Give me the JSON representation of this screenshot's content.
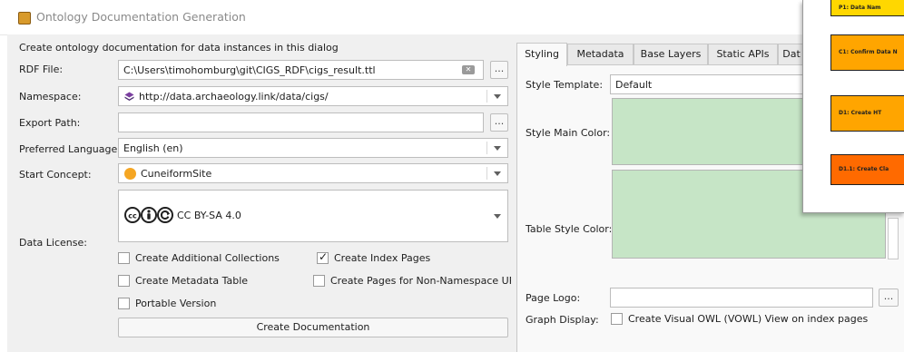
{
  "window": {
    "title": "Ontology Documentation Generation"
  },
  "left": {
    "intro": "Create ontology documentation for data instances in this dialog",
    "rdf_file": {
      "label": "RDF File:",
      "value": "C:\\Users\\timohomburg\\git\\CIGS_RDF\\cigs_result.ttl",
      "browse": "..."
    },
    "namespace": {
      "label": "Namespace:",
      "value": "http://data.archaeology.link/data/cigs/"
    },
    "export_path": {
      "label": "Export Path:",
      "value": "",
      "browse": "..."
    },
    "preferred_language": {
      "label": "Preferred Language:",
      "value": "English (en)"
    },
    "start_concept": {
      "label": "Start Concept:",
      "value": "CuneiformSite"
    },
    "data_license": {
      "label": "Data License:",
      "value": "CC BY-SA 4.0"
    },
    "checkboxes": {
      "additional_collections": {
        "label": "Create Additional Collections",
        "checked": false
      },
      "index_pages": {
        "label": "Create Index Pages",
        "checked": true
      },
      "metadata_table": {
        "label": "Create Metadata Table",
        "checked": false
      },
      "non_namespace": {
        "label": "Create Pages for Non-Namespace URIs",
        "checked": false
      },
      "portable": {
        "label": "Portable Version",
        "checked": false
      }
    },
    "create_button": "Create Documentation"
  },
  "right": {
    "tabs": [
      "Styling",
      "Metadata",
      "Base Layers",
      "Static APIs",
      "Dat"
    ],
    "active_tab": "Styling",
    "style_template": {
      "label": "Style Template:",
      "value": "Default"
    },
    "style_main_color": {
      "label": "Style Main Color:",
      "color": "#c6e5c6"
    },
    "table_style_color": {
      "label": "Table Style Color:",
      "color": "#c6e5c6"
    },
    "page_logo": {
      "label": "Page Logo:",
      "value": "",
      "browse": "..."
    },
    "graph_display": {
      "label": "Graph Display:",
      "checkbox_label": "Create Visual OWL (VOWL) View on index pages",
      "checked": false
    }
  },
  "diagram": {
    "boxes": [
      {
        "text": "P1: Data Nam",
        "color": "#ffd700"
      },
      {
        "text": "C1: Confirm Data N",
        "color": "#ffa500"
      },
      {
        "text": "D1: Create HT",
        "color": "#ffa500"
      },
      {
        "text": "D1.1: Create Cla",
        "color": "#ff6a00"
      }
    ]
  },
  "colors": {
    "accent_green": "#c6e5c6",
    "license_badge": "#202020",
    "concept_dot": "#f5a623"
  }
}
